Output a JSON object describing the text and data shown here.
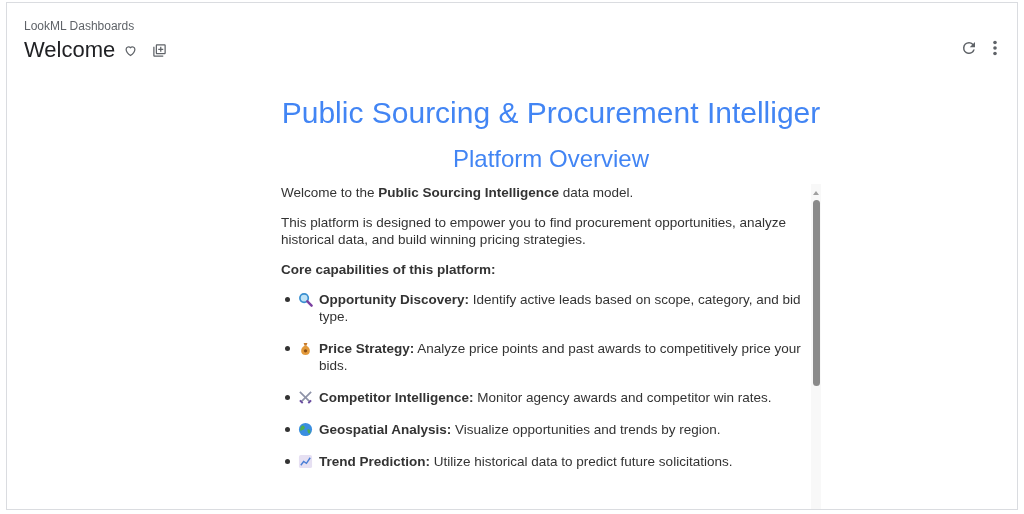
{
  "header": {
    "breadcrumb": "LookML Dashboards",
    "title": "Welcome",
    "favorite": false
  },
  "content": {
    "title": "Public Sourcing & Procurement Intelliger",
    "subtitle": "Platform Overview",
    "paragraphs": [
      "Welcome to the **Public Sourcing Intelligence** data model.",
      "This platform is designed to empower you to find procurement opportunities, analyze historical data, and build winning pricing strategies."
    ],
    "list_heading": "Core capabilities of this platform:",
    "items": [
      {
        "kind": "search",
        "text": "**Opportunity Discovery:** Identify active leads based on scope, category, and bid type."
      },
      {
        "kind": "money",
        "text": "**Price Strategy:** Analyze price points and past awards to competitively price your bids."
      },
      {
        "kind": "swords",
        "text": "**Competitor Intelligence:** Monitor agency awards and competitor win rates."
      },
      {
        "kind": "globe",
        "text": "**Geospatial Analysis:** Visualize opportunities and trends by region."
      },
      {
        "kind": "chart",
        "text": "**Trend Prediction:** Utilize historical data to predict future solicitations."
      }
    ]
  }
}
